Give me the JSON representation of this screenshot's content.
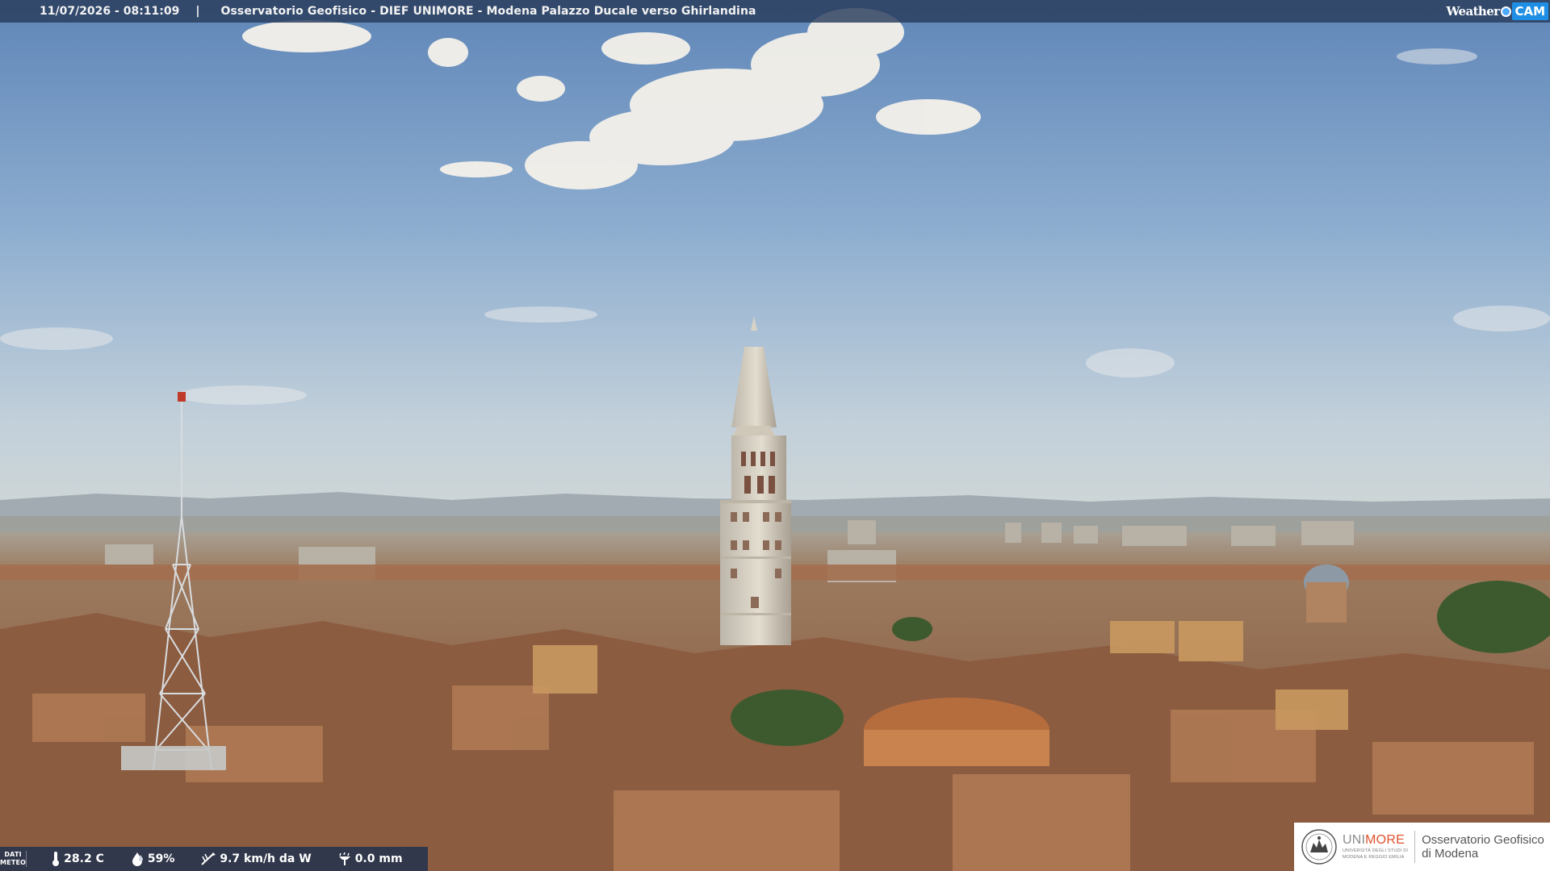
{
  "topbar": {
    "timestamp": "11/07/2026 - 08:11:09",
    "separator": "|",
    "caption": "Osservatorio Geofisico - DIEF UNIMORE - Modena Palazzo Ducale verso Ghirlandina",
    "brand_weather": "Weather",
    "brand_cam": "CAM"
  },
  "meteo": {
    "label_line1": "DATI",
    "label_line2": "METEO",
    "temperature": "28.2 C",
    "humidity": "59%",
    "wind": "9.7 km/h da W",
    "rain": "0.0 mm",
    "icons": [
      "thermometer-icon",
      "humidity-drop-icon",
      "wind-vane-icon",
      "rain-gauge-icon"
    ]
  },
  "logo": {
    "uni_part1": "UNI",
    "uni_part2": "MORE",
    "uni_sub1": "UNIVERSITÀ DEGLI STUDI DI",
    "uni_sub2": "MODENA E REGGIO EMILIA",
    "observatory_line1": "Osservatorio Geofisico",
    "observatory_line2": "di Modena"
  },
  "colors": {
    "sky_top": "#5f86b8",
    "sky_bottom": "#c9d4d8",
    "roofs": "#9a6a4c",
    "unimore_orange": "#e0522d",
    "weathercam_blue": "#1f8fe6"
  }
}
